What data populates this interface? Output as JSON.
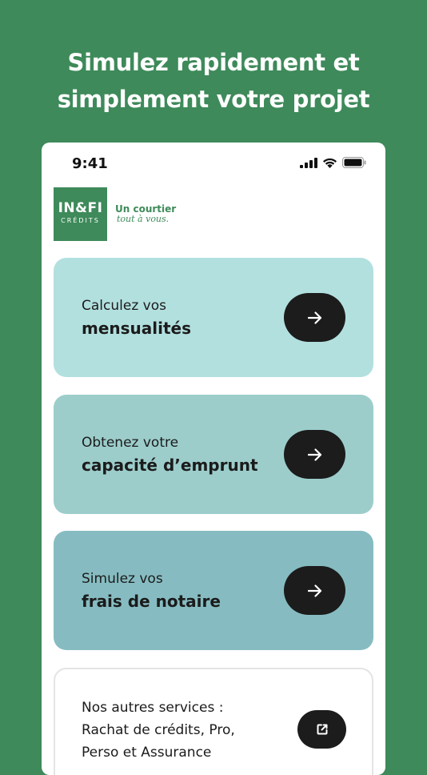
{
  "headline": {
    "line1": "Simulez rapidement et",
    "line2": "simplement votre projet"
  },
  "status_bar": {
    "time": "9:41"
  },
  "logo": {
    "main": "IN&FI",
    "sub": "CRÉDITS",
    "tagline1": "Un courtier",
    "tagline2": "tout à vous."
  },
  "cards": [
    {
      "line1": "Calculez vos",
      "line2": "mensualités",
      "color": "#b2e0df"
    },
    {
      "line1": "Obtenez votre",
      "line2": "capacité d’emprunt",
      "color": "#9ccdcb"
    },
    {
      "line1": "Simulez vos",
      "line2": "frais de notaire",
      "color": "#86bcc1"
    }
  ],
  "services": {
    "line1": "Nos autres services :",
    "line2": "Rachat de crédits, Pro,",
    "line3": "Perso et Assurance"
  },
  "colors": {
    "background": "#3e8a5a",
    "button": "#1c1c1c"
  },
  "icons": [
    "signal-icon",
    "wifi-icon",
    "battery-icon",
    "arrow-right-icon",
    "external-link-icon"
  ]
}
